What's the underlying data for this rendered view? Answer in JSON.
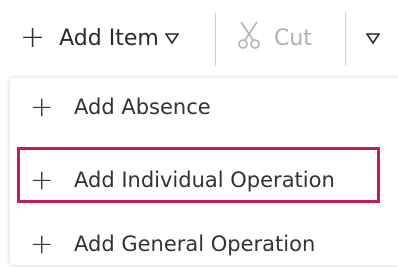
{
  "toolbar": {
    "add_item_label": "Add Item",
    "cut_label": "Cut",
    "add_icon": "plus-icon",
    "dropdown_icon": "triangle-down-icon",
    "cut_icon": "scissors-icon"
  },
  "menu": {
    "items": [
      {
        "label": "Add Absence",
        "icon": "plus-icon"
      },
      {
        "label": "Add Individual Operation",
        "icon": "plus-icon",
        "highlighted": true
      },
      {
        "label": "Add General Operation",
        "icon": "plus-icon"
      }
    ],
    "highlight_color": "#c51c5c"
  }
}
